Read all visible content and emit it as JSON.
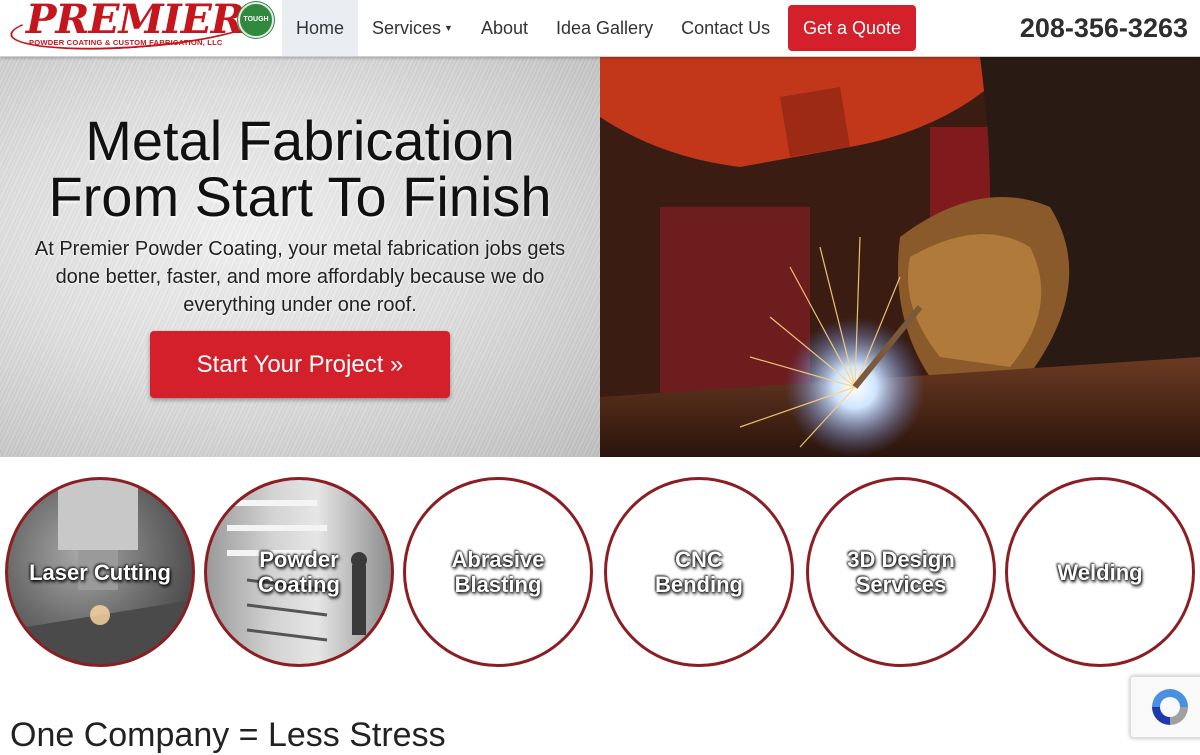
{
  "logo": {
    "name": "PREMIER",
    "tagline": "POWDER COATING & CUSTOM FABRICATION, LLC",
    "seal": "TOUGH"
  },
  "nav": {
    "items": [
      {
        "label": "Home",
        "active": true
      },
      {
        "label": "Services",
        "dropdown": true
      },
      {
        "label": "About"
      },
      {
        "label": "Idea Gallery"
      },
      {
        "label": "Contact Us"
      }
    ],
    "quote_label": "Get a Quote",
    "phone": "208-356-3263"
  },
  "hero": {
    "title_line1": "Metal Fabrication",
    "title_line2": "From Start To Finish",
    "subtitle": "At Premier Powder Coating, your metal fabrication jobs gets done better, faster, and more affordably because we do everything under one roof.",
    "cta_label": "Start Your Project »"
  },
  "services": [
    {
      "line1": "Laser Cutting",
      "line2": ""
    },
    {
      "line1": "Powder",
      "line2": "Coating"
    },
    {
      "line1": "Abrasive",
      "line2": "Blasting"
    },
    {
      "line1": "CNC",
      "line2": "Bending"
    },
    {
      "line1": "3D Design",
      "line2": "Services"
    },
    {
      "line1": "Welding",
      "line2": ""
    }
  ],
  "section_heading": "One Company = Less Stress",
  "colors": {
    "brand_red": "#d3202a",
    "circle_border": "#8c1d22"
  }
}
